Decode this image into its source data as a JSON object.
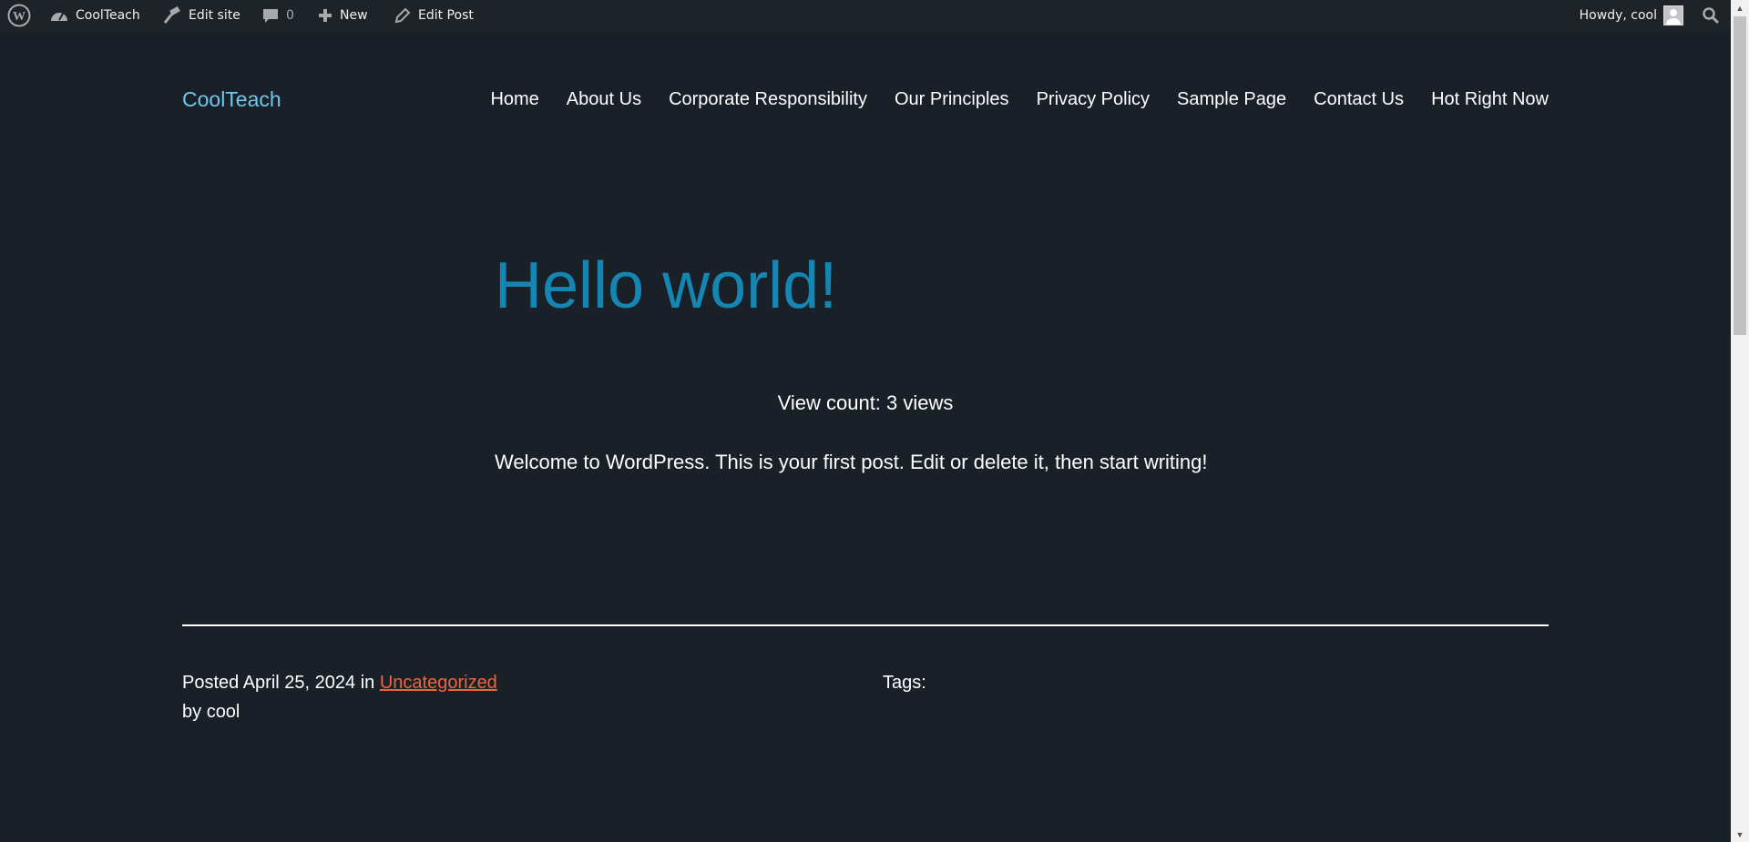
{
  "admin_bar": {
    "site_name": "CoolTeach",
    "edit_site": "Edit site",
    "comments_count": "0",
    "new": "New",
    "edit_post": "Edit Post",
    "howdy": "Howdy, cool"
  },
  "header": {
    "site_title": "CoolTeach",
    "nav": [
      "Home",
      "About Us",
      "Corporate Responsibility",
      "Our Principles",
      "Privacy Policy",
      "Sample Page",
      "Contact Us",
      "Hot Right Now"
    ]
  },
  "post": {
    "title": "Hello world!",
    "view_count": "View count: 3 views",
    "body": "Welcome to WordPress. This is your first post. Edit or delete it, then start writing!"
  },
  "meta": {
    "posted_label": "Posted",
    "date": "April 25, 2024",
    "in_label": "in",
    "category": "Uncategorized",
    "by_label": "by",
    "author": "cool",
    "tags_label": "Tags:"
  },
  "colors": {
    "background": "#192028",
    "admin_bar": "#1d2327",
    "site_title": "#6fc7ec",
    "post_title": "#1585b2",
    "link": "#f0643d"
  }
}
